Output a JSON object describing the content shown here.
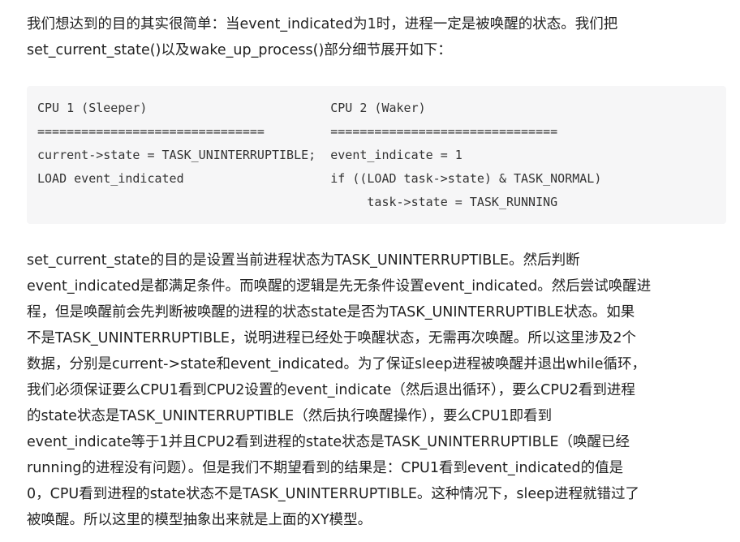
{
  "intro": {
    "lines": [
      "我们想达到的目的其实很简单：当event_indicated为1时，进程一定是被唤醒的状态。我们把",
      "set_current_state()以及wake_up_process()部分细节展开如下："
    ]
  },
  "code": {
    "lines": [
      "CPU 1 (Sleeper)                         CPU 2 (Waker)",
      "===============================         ===============================",
      "current->state = TASK_UNINTERRUPTIBLE;  event_indicate = 1",
      "LOAD event_indicated                    if ((LOAD task->state) & TASK_NORMAL)",
      "                                             task->state = TASK_RUNNING"
    ]
  },
  "body": {
    "lines": [
      "set_current_state的目的是设置当前进程状态为TASK_UNINTERRUPTIBLE。然后判断",
      "event_indicated是都满足条件。而唤醒的逻辑是先无条件设置event_indicated。然后尝试唤醒进",
      "程，但是唤醒前会先判断被唤醒的进程的状态state是否为TASK_UNINTERRUPTIBLE状态。如果",
      "不是TASK_UNINTERRUPTIBLE，说明进程已经处于唤醒状态，无需再次唤醒。所以这里涉及2个",
      "数据，分别是current->state和event_indicated。为了保证sleep进程被唤醒并退出while循环，",
      "我们必须保证要么CPU1看到CPU2设置的event_indicate（然后退出循环），要么CPU2看到进程",
      "的state状态是TASK_UNINTERRUPTIBLE（然后执行唤醒操作），要么CPU1即看到",
      "event_indicate等于1并且CPU2看到进程的state状态是TASK_UNINTERRUPTIBLE（唤醒已经",
      "running的进程没有问题）。但是我们不期望看到的结果是：CPU1看到event_indicated的值是",
      "0，CPU看到进程的state状态不是TASK_UNINTERRUPTIBLE。这种情况下，sleep进程就错过了",
      "被唤醒。所以这里的模型抽象出来就是上面的XY模型。"
    ]
  }
}
